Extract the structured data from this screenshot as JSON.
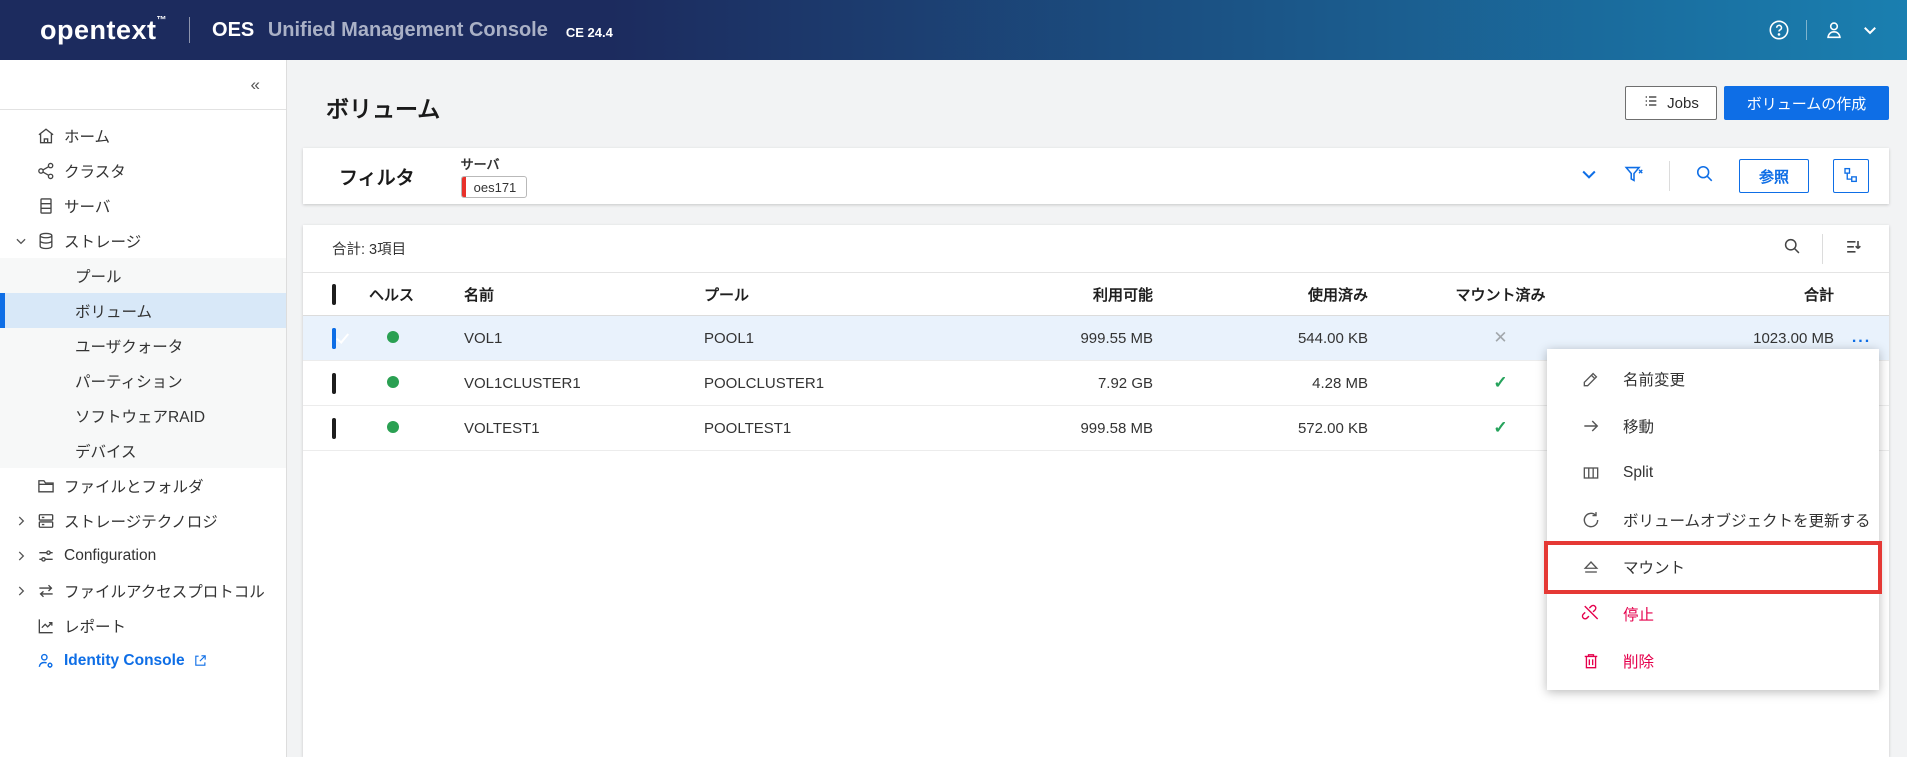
{
  "header": {
    "logo": "opentext",
    "logo_tm": "™",
    "product_bold": "OES",
    "product_rest": "Unified Management Console",
    "version": "CE 24.4"
  },
  "sidebar": {
    "collapse": "«",
    "items": {
      "home": "ホーム",
      "cluster": "クラスタ",
      "server": "サーバ",
      "storage": "ストレージ",
      "pool": "プール",
      "volume": "ボリューム",
      "user_quota": "ユーザクォータ",
      "partition": "パーティション",
      "software_raid": "ソフトウェアRAID",
      "device": "デバイス",
      "files_folders": "ファイルとフォルダ",
      "storage_tech": "ストレージテクノロジ",
      "configuration": "Configuration",
      "file_access": "ファイルアクセスプロトコル",
      "reports": "レポート",
      "identity_console": "Identity Console"
    }
  },
  "page": {
    "title": "ボリューム",
    "jobs_button": "Jobs",
    "create_button": "ボリュームの作成"
  },
  "filter": {
    "label": "フィルタ",
    "field_label": "サーバ",
    "chip_value": "oes171",
    "browse_button": "参照"
  },
  "table": {
    "summary": "合計: 3項目",
    "columns": {
      "health": "ヘルス",
      "name": "名前",
      "pool": "プール",
      "available": "利用可能",
      "used": "使用済み",
      "mounted": "マウント済み",
      "total": "合計"
    },
    "rows": [
      {
        "checked": true,
        "health": "green",
        "name": "VOL1",
        "pool": "POOL1",
        "available": "999.55 MB",
        "used": "544.00 KB",
        "mounted": false,
        "total": "1023.00 MB",
        "actions": "..."
      },
      {
        "checked": false,
        "health": "green",
        "name": "VOL1CLUSTER1",
        "pool": "POOLCLUSTER1",
        "available": "7.92 GB",
        "used": "4.28 MB",
        "mounted": true,
        "total": ""
      },
      {
        "checked": false,
        "health": "green",
        "name": "VOLTEST1",
        "pool": "POOLTEST1",
        "available": "999.58 MB",
        "used": "572.00 KB",
        "mounted": true,
        "total": ""
      }
    ]
  },
  "context_menu": {
    "items": [
      {
        "label": "名前変更",
        "icon": "rename-icon"
      },
      {
        "label": "移動",
        "icon": "move-icon"
      },
      {
        "label": "Split",
        "icon": "split-icon"
      },
      {
        "label": "ボリュームオブジェクトを更新する",
        "icon": "refresh-icon"
      },
      {
        "label": "マウント",
        "icon": "mount-icon",
        "highlighted": true
      },
      {
        "label": "停止",
        "icon": "dismount-icon",
        "danger": true
      },
      {
        "label": "削除",
        "icon": "delete-icon",
        "danger": true
      }
    ]
  },
  "colors": {
    "accent_blue": "#0e6ee6",
    "danger_pink": "#e5004c",
    "health_green": "#2aa052",
    "highlight_red": "#e53935",
    "header_navy": "#1c2b5e",
    "header_teal": "#1a7fb0"
  }
}
